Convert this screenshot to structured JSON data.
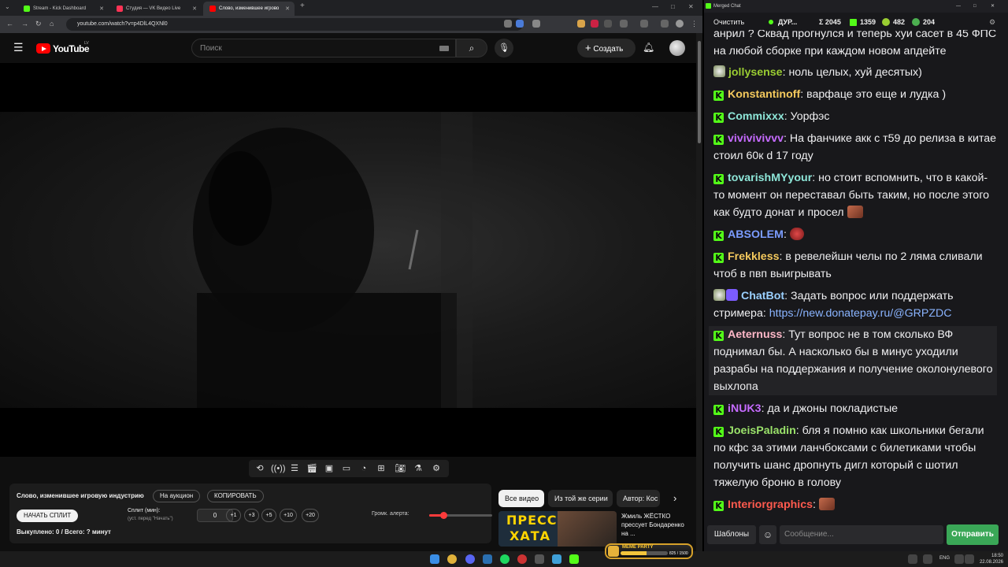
{
  "browser": {
    "tabs": [
      {
        "title": "Stream - Kick Dashboard",
        "color": "#53fc18"
      },
      {
        "title": "Студия — VK Видео Live",
        "color": "#ff3355"
      },
      {
        "title": "Слово, изменившее игрово",
        "color": "#ff0000"
      }
    ],
    "new_tab": "+",
    "url": "youtube.com/watch?v=p4DlL4QXNl0"
  },
  "youtube": {
    "logo": "YouTube",
    "region": "LV",
    "search_placeholder": "Поиск",
    "create_label": "Создать"
  },
  "panel": {
    "video_title": "Слово, изменившее игровую индустрию",
    "auction_btn": "На аукцион",
    "copy_btn": "КОПИРОВАТЬ",
    "start_split_btn": "НАЧАТЬ СПЛИТ",
    "split_label": "Сплит (мин):",
    "split_hint": "(уст. перед \"Начать\")",
    "split_value": "0",
    "increments": [
      "+1",
      "+3",
      "+5",
      "+10",
      "+20"
    ],
    "volume_label": "Громк. алерта:",
    "volume_level": 0.22,
    "bought": "Выкуплено: 0 / Всего: ? минут"
  },
  "recommendations": {
    "chips": [
      "Все видео",
      "Из той же серии",
      "Автор: Кос"
    ],
    "thumb_text_1": "ПРЕСС",
    "thumb_text_2": "ХАТА",
    "video_title": "Жмиль ЖЁСТКО прессует Бондаренко на ..."
  },
  "chat": {
    "window_title": "Merged Chat",
    "clear_btn": "Очистить",
    "stats": {
      "status": "ДУР...",
      "total": "Σ 2045",
      "kick": "1359",
      "vk": "482",
      "other": "204"
    },
    "messages": [
      {
        "platform": "",
        "user": "",
        "user_color": "#efeff1",
        "text": "анрил ? Сквад прогнулся и теперь хуи сасет в 45 ФПС на любой сборке при каждом новом апдейте"
      },
      {
        "platform": "vk",
        "user": "jollysense",
        "user_color": "#9acd32",
        "text": "ноль целых, хуй десятых)"
      },
      {
        "platform": "kick",
        "user": "Konstantinoff",
        "user_color": "#f4c95d",
        "text": "варфаце это еще и лудка )"
      },
      {
        "platform": "kick",
        "user": "Commixxx",
        "user_color": "#8ee6d8",
        "text": "Уорфэс"
      },
      {
        "platform": "kick",
        "user": "vivivivivvv",
        "user_color": "#c66bff",
        "text": "На фанчике акк с т59 до релиза в китае стоил 60к  d 17 году"
      },
      {
        "platform": "kick",
        "user": "tovarishMYyour",
        "user_color": "#8ee6d8",
        "text": "но стоит вспомнить, что в какой-то момент он переставал быть таким, но после этого как будто донат и просел"
      },
      {
        "platform": "kick",
        "user": "ABSOLEM",
        "user_color": "#7b9cff",
        "text": ""
      },
      {
        "platform": "kick",
        "user": "Frekkless",
        "user_color": "#f4c95d",
        "text": "в ревелейшн челы по 2 ляма сливали чтоб в пвп выигрывать"
      },
      {
        "platform": "vk",
        "user": "ChatBot",
        "user_color": "#9ad0ff",
        "text": "Задать вопрос или поддержать стримера:",
        "link": "https://new.donatepay.ru/@GRPZDC"
      },
      {
        "platform": "kick",
        "user": "Aeternuss",
        "user_color": "#ffb8c8",
        "text": "Тут вопрос не в том сколько ВФ поднимал бы. А насколько бы в минус уходили разрабы на поддержания и получение околонулевого выхлопа"
      },
      {
        "platform": "kick",
        "user": "iNUK3",
        "user_color": "#c66bff",
        "text": "да и джоны покладистые"
      },
      {
        "platform": "kick",
        "user": "JoeisPaladin",
        "user_color": "#9be36b",
        "text": "бля я помню как школьники бегали по кфс за этими ланчбоксами с билетиками чтобы получить шанс дропнуть дигл который с шотил тяжелую броню в голову"
      },
      {
        "platform": "kick",
        "user": "Interiorgraphics",
        "user_color": "#ff5a4e",
        "text": ""
      }
    ],
    "templates_btn": "Шаблоны",
    "input_placeholder": "Сообщение...",
    "send_btn": "Отправить"
  },
  "taskbar": {
    "lang": "ENG",
    "time": "18:50",
    "date": "22.08.2026"
  },
  "meme_party": {
    "label": "MEME PARTY",
    "count": "825 / 1500",
    "progress": 0.55
  }
}
